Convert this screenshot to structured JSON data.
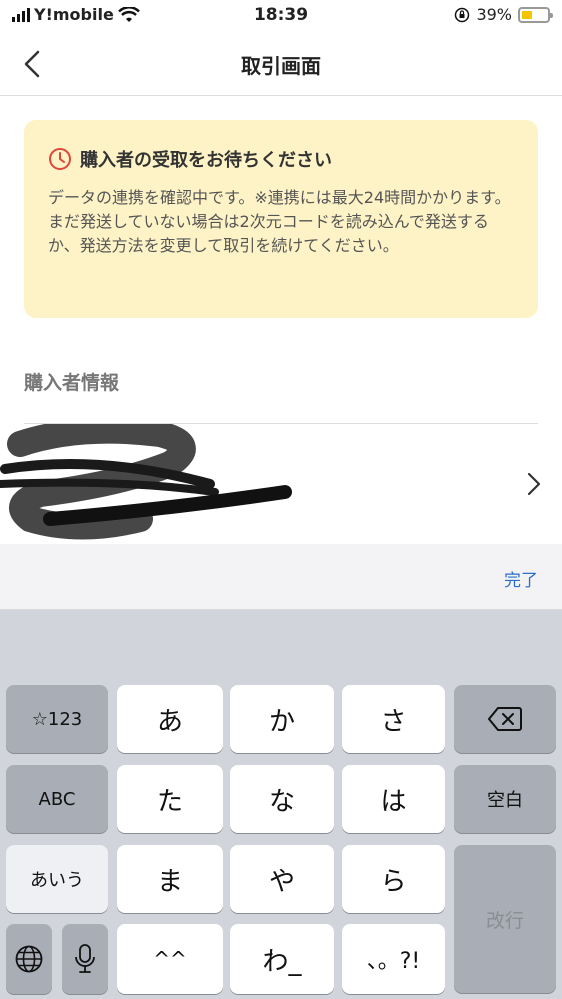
{
  "status_bar": {
    "carrier": "Y!mobile",
    "time": "18:39",
    "battery": "39%"
  },
  "nav": {
    "title": "取引画面"
  },
  "notice": {
    "heading": "購入者の受取をお待ちください",
    "body": "データの連携を確認中です。※連携には最大24時間かかります。まだ発送していない場合は2次元コードを読み込んで発送するか、発送方法を変更して取引を続けてください。"
  },
  "buyer": {
    "section_label": "購入者情報"
  },
  "accessory": {
    "done_label": "完了"
  },
  "keyboard": {
    "symbols_key": "☆123",
    "abc_key": "ABC",
    "kana_key": "あいう",
    "space_key": "空白",
    "enter_key": "改行",
    "kana_rows": [
      [
        "あ",
        "か",
        "さ"
      ],
      [
        "た",
        "な",
        "は"
      ],
      [
        "ま",
        "や",
        "ら"
      ],
      [
        "^^",
        "わ_",
        "、。?!"
      ]
    ]
  },
  "colors": {
    "notice_bg": "#fdf3c6",
    "notice_icon": "#e0463a",
    "link": "#2a6fc9"
  }
}
